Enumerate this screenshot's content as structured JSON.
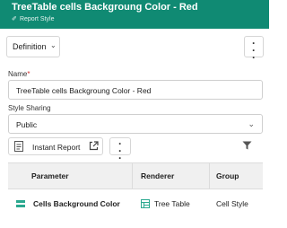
{
  "header": {
    "title": "TreeTable cells Backgroung Color - Red",
    "subtitle": "Report Style",
    "subtitle_icon": "pencil-icon",
    "background_color": "#108a73"
  },
  "toolbar": {
    "definition_label": "Definition",
    "definition_icon": "chevron-down-icon",
    "more_icon": "kebab-menu-icon"
  },
  "form": {
    "name_label": "Name",
    "name_required_marker": "*",
    "name_value": "TreeTable cells Backgroung Color - Red",
    "sharing_label": "Style Sharing",
    "sharing_value": "Public"
  },
  "actions": {
    "instant_report_label": "Instant Report",
    "instant_report_icon": "report-icon",
    "open_external_icon": "external-link-icon",
    "filter_icon": "filter-icon"
  },
  "table": {
    "columns": [
      "Parameter",
      "Renderer",
      "Group"
    ],
    "rows": [
      {
        "parameter": "Cells Background Color",
        "renderer": "Tree Table",
        "group": "Cell Style",
        "parameter_icon": "color-swatch-icon",
        "renderer_icon": "tree-table-icon"
      }
    ]
  }
}
